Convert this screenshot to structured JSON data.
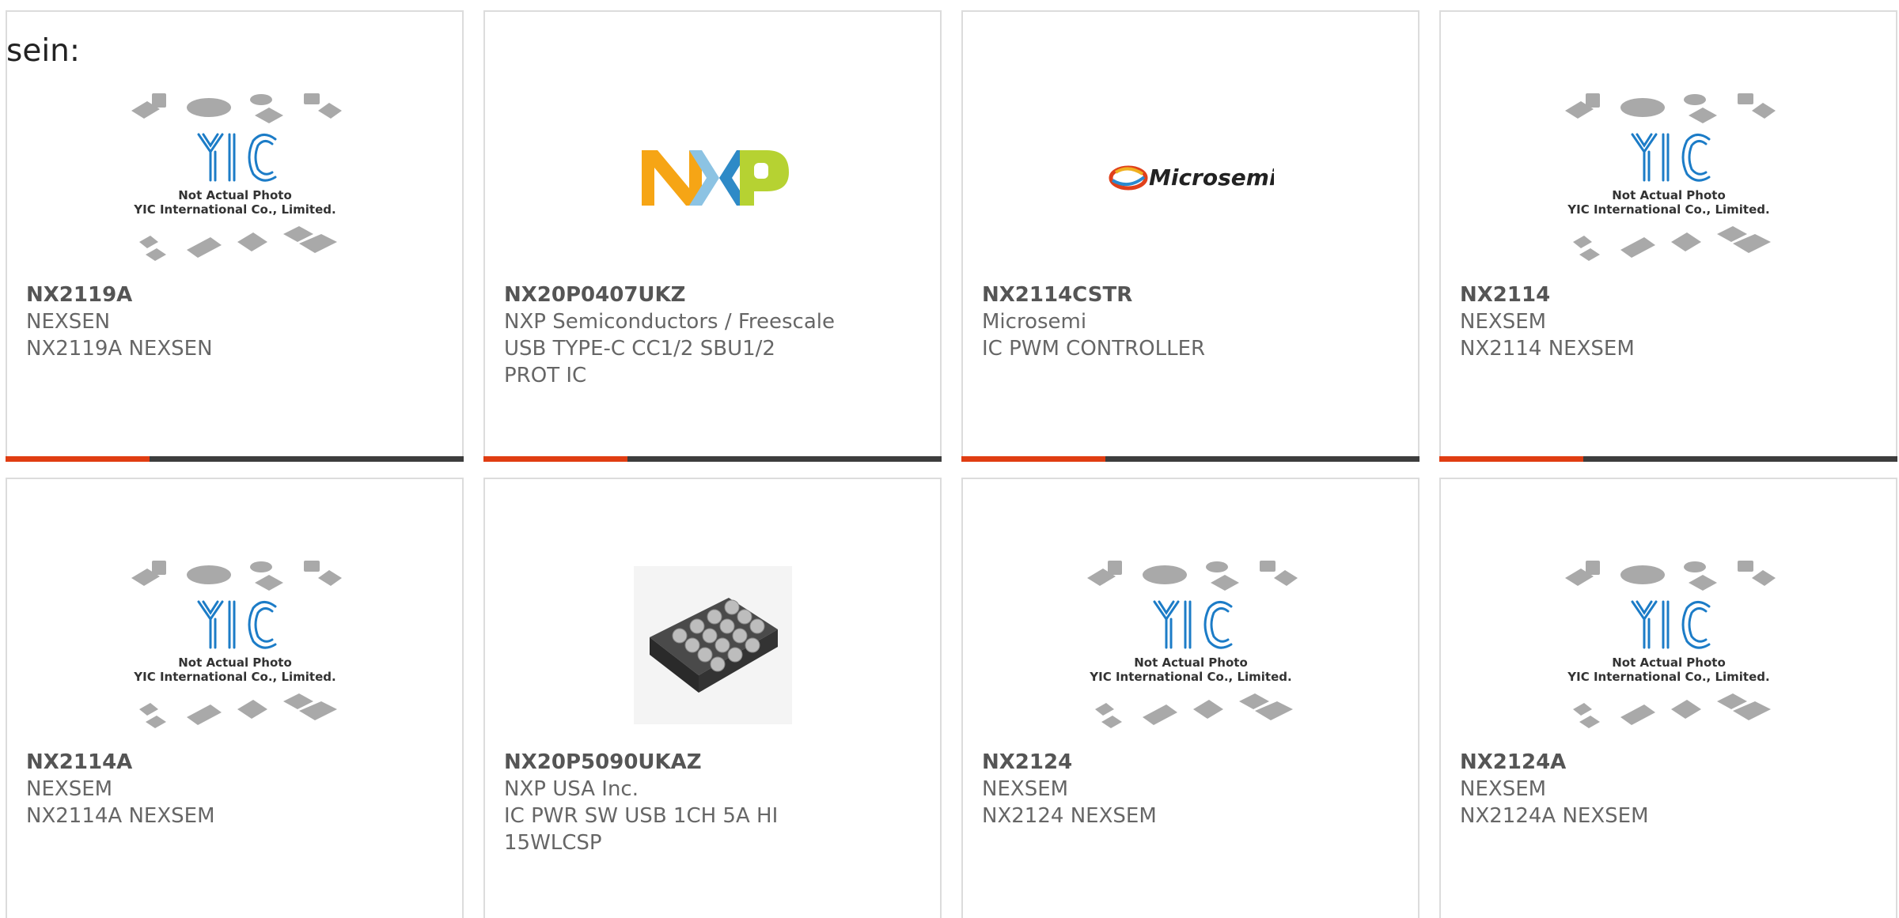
{
  "page": {
    "lead_text": "sein:"
  },
  "products": [
    {
      "part_number": "NX2119A",
      "manufacturer": "NEXSEN",
      "description": "NX2119A NEXSEN",
      "image": "yic-placeholder",
      "image_text": [
        "Not Actual Photo",
        "YIC International Co., Limited."
      ]
    },
    {
      "part_number": "NX20P0407UKZ",
      "manufacturer": "NXP Semiconductors / Freescale",
      "description": "USB TYPE-C CC1/2 SBU1/2 PROT IC",
      "image": "nxp-logo",
      "image_text": [
        "NXP"
      ]
    },
    {
      "part_number": "NX2114CSTR",
      "manufacturer": "Microsemi",
      "description": "IC PWM CONTROLLER",
      "image": "microsemi-logo",
      "image_text": [
        "Microsemi"
      ]
    },
    {
      "part_number": "NX2114",
      "manufacturer": "NEXSEM",
      "description": "NX2114 NEXSEM",
      "image": "yic-placeholder",
      "image_text": [
        "Not Actual Photo",
        "YIC International Co., Limited."
      ]
    },
    {
      "part_number": "NX2114A",
      "manufacturer": "NEXSEM",
      "description": "NX2114A NEXSEM",
      "image": "yic-placeholder",
      "image_text": [
        "Not Actual Photo",
        "YIC International Co., Limited."
      ]
    },
    {
      "part_number": "NX20P5090UKAZ",
      "manufacturer": "NXP USA Inc.",
      "description": "IC PWR SW USB 1CH 5A HI 15WLCSP",
      "image": "wlcsp-chip-photo",
      "image_text": []
    },
    {
      "part_number": "NX2124",
      "manufacturer": "NEXSEM",
      "description": "NX2124 NEXSEM",
      "image": "yic-placeholder",
      "image_text": [
        "Not Actual Photo",
        "YIC International Co., Limited."
      ]
    },
    {
      "part_number": "NX2124A",
      "manufacturer": "NEXSEM",
      "description": "NX2124A NEXSEM",
      "image": "yic-placeholder",
      "image_text": [
        "Not Actual Photo",
        "YIC International Co., Limited."
      ]
    }
  ],
  "colors": {
    "accent": "#e03d12",
    "bar_dark": "#3d3d3d",
    "card_border": "#dcdcdc",
    "text": "#666666",
    "yic_blue": "#1c7cc7"
  }
}
